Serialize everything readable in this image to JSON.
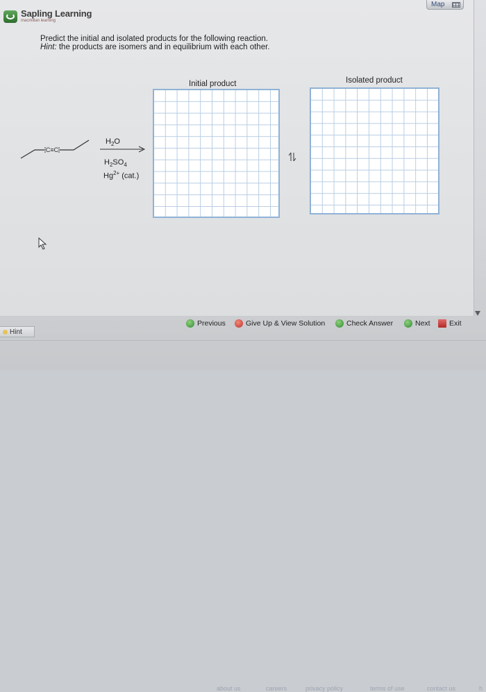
{
  "header": {
    "map_label": "Map",
    "logo_title": "Sapling Learning",
    "logo_subtitle": "macmillan learning"
  },
  "question": {
    "prompt": "Predict the initial and isolated products for the following reaction.",
    "hint_label": "Hint:",
    "hint_text": " the products are isomers and in equilibrium with each other."
  },
  "reaction": {
    "alkyne_center": "C≡C",
    "reagent_top": "H",
    "reagent_top_sub": "2",
    "reagent_top_end": "O",
    "reagent_mid": "H",
    "reagent_mid_sub": "2",
    "reagent_mid_end": "SO",
    "reagent_mid_sub2": "4",
    "reagent_bot": "Hg",
    "reagent_bot_sup": "2+",
    "reagent_bot_end": " (cat.)"
  },
  "grids": {
    "initial_title": "Initial product",
    "isolated_title": "Isolated product"
  },
  "nav": {
    "hint": "Hint",
    "previous": "Previous",
    "give_up": "Give Up & View Solution",
    "check_answer": "Check Answer",
    "next": "Next",
    "exit": "Exit"
  },
  "footer": {
    "links": [
      "about us",
      "careers",
      "privacy policy",
      "terms of use",
      "contact us",
      "h"
    ]
  }
}
